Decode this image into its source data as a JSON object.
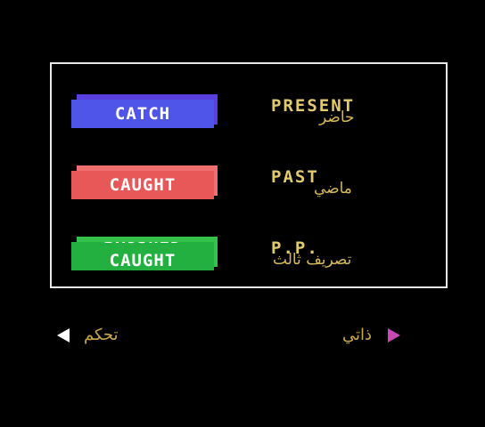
{
  "rows": [
    {
      "button": "CATCH",
      "tense": "PRESENT",
      "arabic": "حاضر",
      "color": "#4f55e8",
      "back": "#5a3fe0"
    },
    {
      "button": "CAUGHT",
      "tense": "PAST",
      "arabic": "ماضي",
      "color": "#e85858",
      "back": "#f07070"
    },
    {
      "button_top": "BRUSHED",
      "button_bottom": "CAUGHT",
      "tense": "P.P.",
      "arabic": "تصريف ثالث",
      "color": "#24b040",
      "back": "#34c24a"
    }
  ],
  "nav": {
    "left_label": "تحكم",
    "right_label": "ذاتي",
    "left_arrow_color": "#ffffff",
    "right_arrow_color": "#c848b8"
  }
}
